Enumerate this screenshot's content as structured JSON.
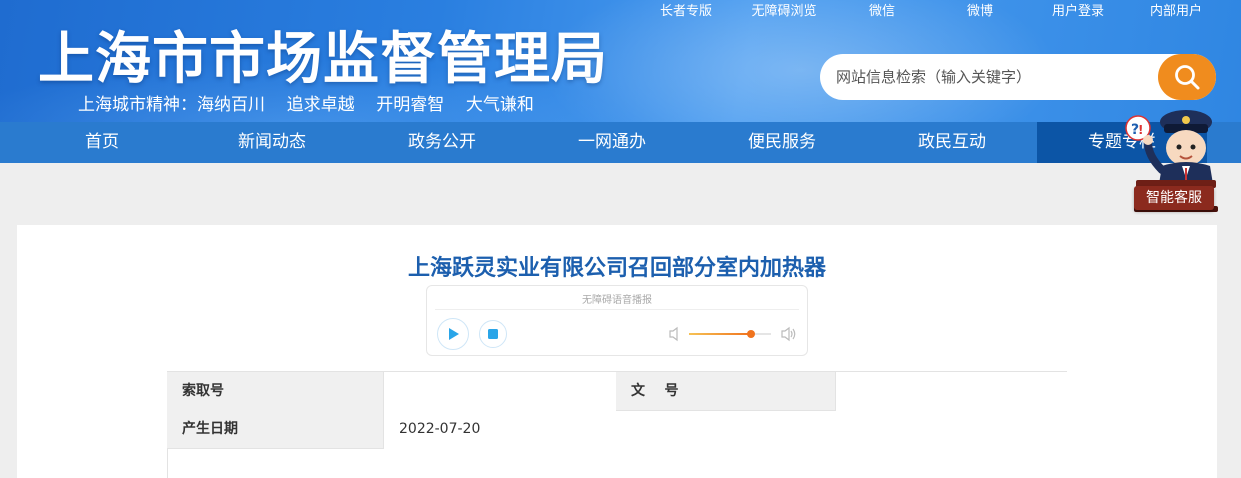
{
  "header": {
    "site_title": "上海市市场监督管理局",
    "slogan": "上海城市精神：海纳百川    追求卓越    开明睿智    大气谦和",
    "top_links": [
      "长者专版",
      "无障碍浏览",
      "微信",
      "微博",
      "用户登录",
      "内部用户"
    ],
    "search_placeholder": "网站信息检索（输入关键字）"
  },
  "nav": {
    "items": [
      "首页",
      "新闻动态",
      "政务公开",
      "一网通办",
      "便民服务",
      "政民互动",
      "专题专栏"
    ],
    "active_index": 6
  },
  "assistant": {
    "label": "智能客服"
  },
  "article": {
    "title": "上海跃灵实业有限公司召回部分室内加热器",
    "player_caption": "无障碍语音播报",
    "volume_level": 0.75,
    "meta": {
      "index_label": "索取号",
      "index_value": "",
      "doc_no_label": "文    号",
      "doc_no_value": "",
      "date_label": "产生日期",
      "date_value": "2022-07-20"
    }
  },
  "colors": {
    "header_blue": "#2a7fe0",
    "nav_blue": "#2a7bcf",
    "nav_active": "#0c55a6",
    "search_button": "#f08c1e",
    "title_blue": "#1c5fae"
  }
}
